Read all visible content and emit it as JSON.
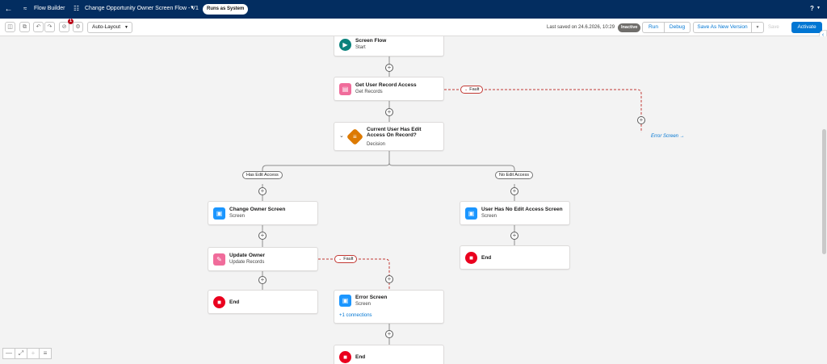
{
  "header": {
    "back_icon": "arrow-left-icon",
    "app_name": "Flow Builder",
    "flow_name": "Change Opportunity Owner Screen Flow - V1",
    "runs_as": "Runs as System",
    "help_label": "?"
  },
  "toolbar": {
    "layout_mode": "Auto-Layout",
    "error_count": "1",
    "last_saved": "Last saved on 24.6.2026, 10:29",
    "status": "Inactive",
    "run_label": "Run",
    "debug_label": "Debug",
    "save_as_label": "Save As New Version",
    "save_label": "Save",
    "activate_label": "Activate"
  },
  "canvas": {
    "start": {
      "title": "Screen Flow",
      "subtitle": "Start"
    },
    "get_records": {
      "title": "Get User Record Access",
      "subtitle": "Get Records"
    },
    "decision": {
      "title": "Current User Has Edit Access On Record?",
      "subtitle": "Decision"
    },
    "outcome_yes": "Has Edit Access",
    "outcome_no": "No Edit Access",
    "change_owner": {
      "title": "Change Owner Screen",
      "subtitle": "Screen"
    },
    "no_access": {
      "title": "User Has No Edit Access Screen",
      "subtitle": "Screen"
    },
    "update_owner": {
      "title": "Update Owner",
      "subtitle": "Update Records"
    },
    "end_label": "End",
    "error_screen": {
      "title": "Error Screen",
      "subtitle": "Screen",
      "connections": "+1 connections"
    },
    "fault_label": "Fault",
    "error_link": "Error Screen →"
  },
  "colors": {
    "header_bg": "#032d60",
    "brand": "#0176d3",
    "start": "#0b827c",
    "records": "#f06c9b",
    "decision": "#dd7a01",
    "screen": "#1b96ff",
    "end": "#ea001e",
    "fault": "#c23934"
  }
}
